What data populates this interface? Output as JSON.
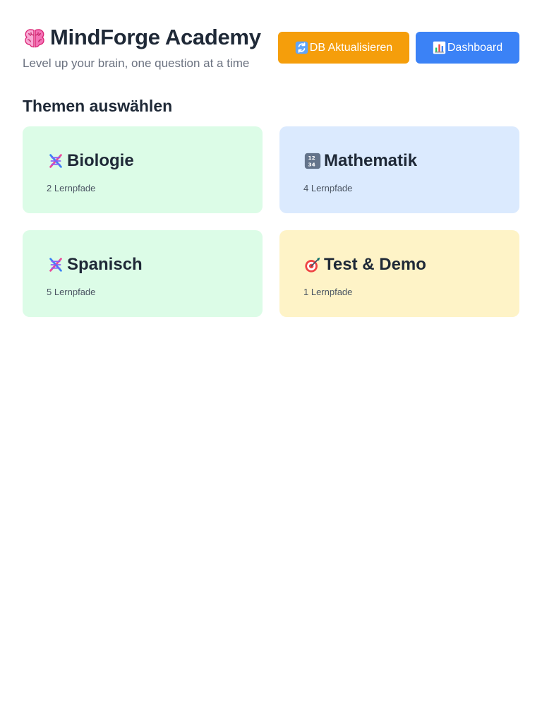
{
  "app": {
    "title": "MindForge Academy",
    "subtitle": "Level up your brain, one question at a time",
    "icon": "brain-icon"
  },
  "toolbar": {
    "refresh_label": "DB Aktualisieren",
    "refresh_icon": "refresh-icon",
    "dashboard_label": "Dashboard",
    "dashboard_icon": "chart-icon"
  },
  "section": {
    "title": "Themen auswählen"
  },
  "topics": [
    {
      "title": "Biologie",
      "count": "2 Lernpfade",
      "icon": "dna-icon",
      "background": "#dcfce7"
    },
    {
      "title": "Mathematik",
      "count": "4 Lernpfade",
      "icon": "numbers-icon",
      "background": "#dbeafe"
    },
    {
      "title": "Spanisch",
      "count": "5 Lernpfade",
      "icon": "dna-icon",
      "background": "#dcfce7"
    },
    {
      "title": "Test & Demo",
      "count": "1 Lernpfade",
      "icon": "target-icon",
      "background": "#fef3c7"
    }
  ],
  "colors": {
    "refresh_button": "#f59e0b",
    "dashboard_button": "#3b82f6",
    "text_primary": "#1f2937",
    "text_secondary": "#6b7280"
  }
}
